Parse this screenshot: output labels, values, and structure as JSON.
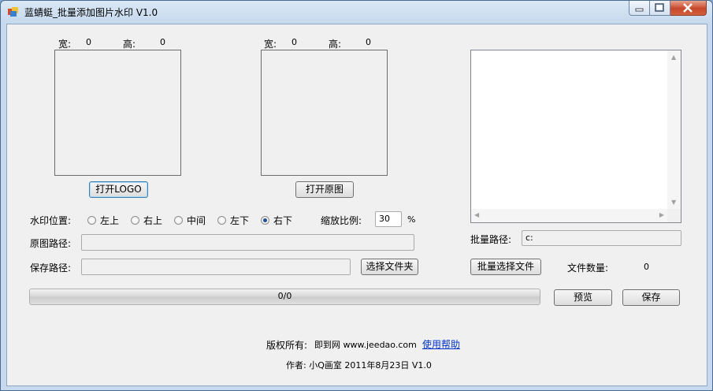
{
  "window": {
    "title": "蓝蜻蜓_批量添加图片水印 V1.0",
    "controls": [
      "minimize-icon",
      "maximize-icon",
      "close-icon"
    ]
  },
  "logo_panel": {
    "width_label": "宽:",
    "width_value": "0",
    "height_label": "高:",
    "height_value": "0",
    "open_button": "打开LOGO"
  },
  "image_panel": {
    "width_label": "宽:",
    "width_value": "0",
    "height_label": "高:",
    "height_value": "0",
    "open_button": "打开原图"
  },
  "watermark": {
    "position_label": "水印位置:",
    "options": [
      "左上",
      "右上",
      "中间",
      "左下",
      "右下"
    ],
    "selected": "右下",
    "scale_label": "缩放比例:",
    "scale_value": "30",
    "scale_unit": "%"
  },
  "paths": {
    "source_label": "原图路径:",
    "source_value": "",
    "save_label": "保存路径:",
    "save_value": "",
    "choose_folder_button": "选择文件夹"
  },
  "batch": {
    "path_label": "批量路径:",
    "path_value": "c:",
    "select_files_button": "批量选择文件",
    "file_count_label": "文件数量:",
    "file_count_value": "0"
  },
  "progress": {
    "text": "0/0",
    "fraction": 0
  },
  "actions": {
    "preview_button": "预览",
    "save_button": "保存"
  },
  "footer": {
    "copyright_label": "版权所有:",
    "copyright_site": "即到网 www.jeedao.com",
    "help_link": "使用帮助",
    "author_line": "作者: 小Q画室 2011年8月23日 V1.0"
  },
  "colors": {
    "accent_link": "#0033cc",
    "radio_dot": "#1f4f9a"
  }
}
